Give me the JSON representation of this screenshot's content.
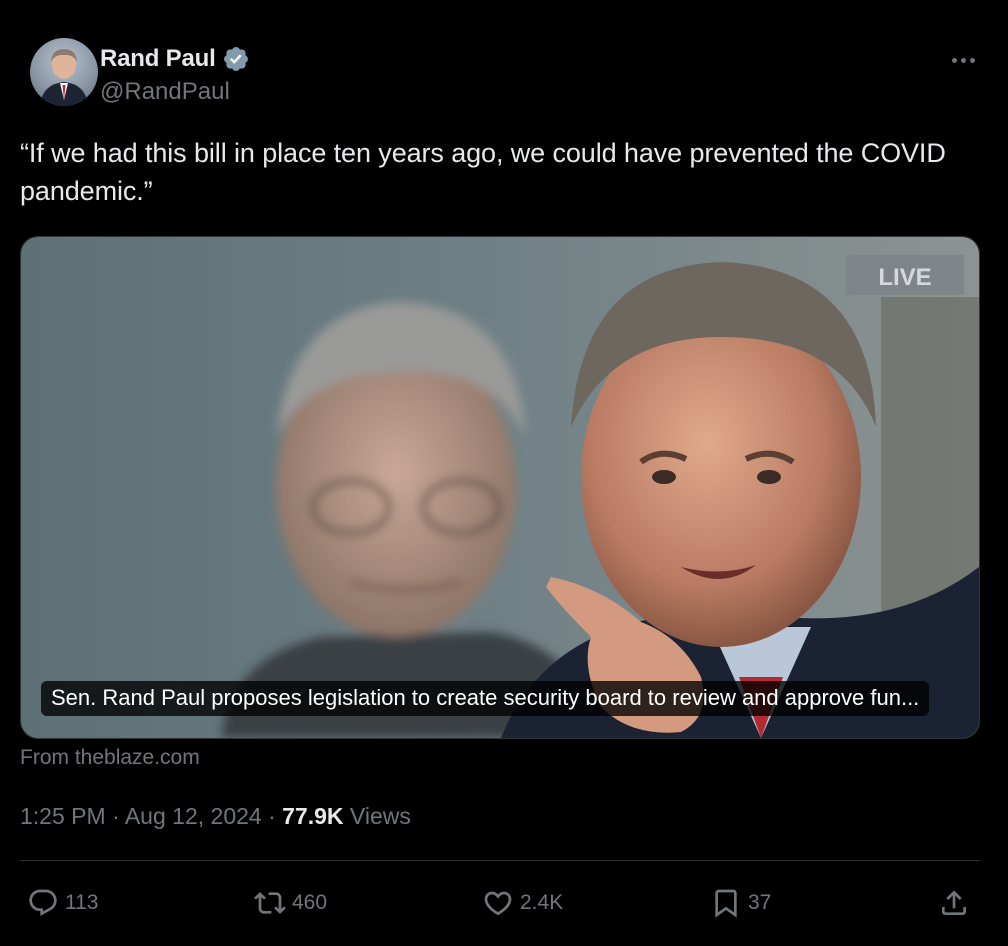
{
  "author": {
    "display_name": "Rand Paul",
    "handle": "@RandPaul",
    "verified": true,
    "verified_color": "#829aab"
  },
  "icons": {
    "more": "more-horizontal-icon",
    "verified": "verified-badge-icon",
    "reply": "reply-icon",
    "retweet": "retweet-icon",
    "like": "like-icon",
    "bookmark": "bookmark-icon",
    "share": "share-icon"
  },
  "tweet": {
    "text": "“If we had this bill in place ten years ago, we could have prevented the COVID pandemic.”"
  },
  "card": {
    "caption": "Sen. Rand Paul proposes legislation to create security board to review and approve fun...",
    "live_label": "LIVE",
    "source": "From theblaze.com"
  },
  "meta": {
    "time": "1:25 PM",
    "separator": "·",
    "date": "Aug 12, 2024",
    "views_count": "77.9K",
    "views_label": "Views"
  },
  "actions": {
    "replies": "113",
    "reposts": "460",
    "likes": "2.4K",
    "bookmarks": "37"
  },
  "colors": {
    "background": "#000000",
    "text": "#e7e9ea",
    "secondary_text": "#71767b",
    "divider": "#2f3336"
  }
}
